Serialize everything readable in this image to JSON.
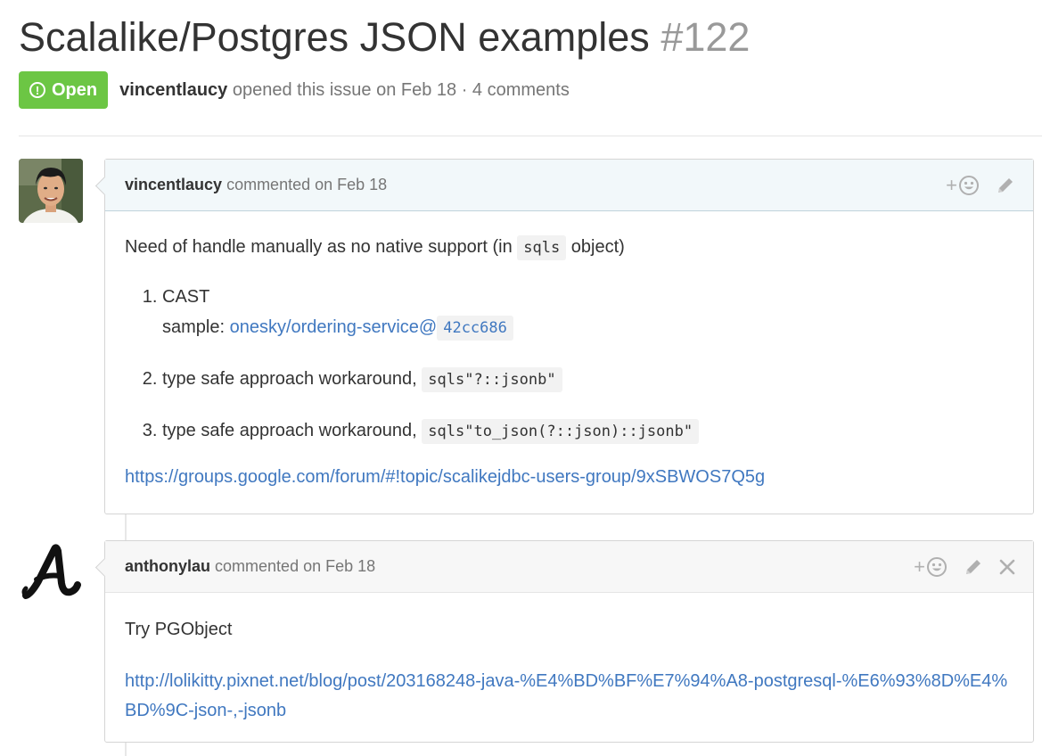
{
  "issue": {
    "title": "Scalalike/Postgres JSON examples",
    "number": "#122",
    "state": "Open",
    "author": "vincentlaucy",
    "opened_text": "opened this issue on Feb 18 · 4 comments",
    "state_color": "#6cc644"
  },
  "comments": [
    {
      "author": "vincentlaucy",
      "action": "commented on Feb 18",
      "intro_before": "Need of handle manually as no native support (in ",
      "intro_code": "sqls",
      "intro_after": " object)",
      "steps": [
        {
          "label": "CAST",
          "sample_prefix": "sample: ",
          "sample_link": "onesky/ordering-service@",
          "sample_commit": "42cc686"
        },
        {
          "text": "type safe approach workaround, ",
          "code": "sqls\"?::jsonb\""
        },
        {
          "text": "type safe approach workaround, ",
          "code": "sqls\"to_json(?::json)::jsonb\""
        }
      ],
      "link": "https://groups.google.com/forum/#!topic/scalikejdbc-users-group/9xSBWOS7Q5g",
      "icons": [
        "add-reaction-icon",
        "pencil-icon"
      ]
    },
    {
      "author": "anthonylau",
      "action": "commented on Feb 18",
      "text": "Try PGObject",
      "link": "http://lolikitty.pixnet.net/blog/post/203168248-java-%E4%BD%BF%E7%94%A8-postgresql-%E6%93%8D%E4%BD%9C-json-,-jsonb",
      "icons": [
        "add-reaction-icon",
        "pencil-icon",
        "close-icon"
      ]
    }
  ],
  "colors": {
    "link": "#4078c0",
    "owner_header_bg": "#f2f8fa",
    "header_bg": "#f7f7f7",
    "muted_text": "#767676"
  }
}
